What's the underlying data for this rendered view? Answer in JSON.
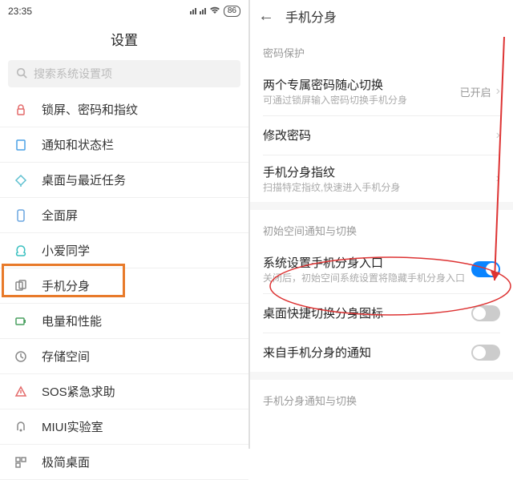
{
  "statusBar": {
    "time": "23:35",
    "battery": "86"
  },
  "left": {
    "title": "设置",
    "searchPlaceholder": "搜索系统设置项",
    "items": [
      {
        "label": "锁屏、密码和指纹",
        "iconColor": "#e46a6a"
      },
      {
        "label": "通知和状态栏",
        "iconColor": "#4aa0e6"
      },
      {
        "label": "桌面与最近任务",
        "iconColor": "#5fc0d0"
      },
      {
        "label": "全面屏",
        "iconColor": "#6aa6e0"
      },
      {
        "label": "小爱同学",
        "iconColor": "#3ac0c0"
      },
      {
        "label": "手机分身",
        "iconColor": "#888"
      },
      {
        "label": "电量和性能",
        "iconColor": "#4aa060"
      },
      {
        "label": "存储空间",
        "iconColor": "#888"
      },
      {
        "label": "SOS紧急求助",
        "iconColor": "#e46a6a"
      },
      {
        "label": "MIUI实验室",
        "iconColor": "#888"
      },
      {
        "label": "极简桌面",
        "iconColor": "#888"
      }
    ],
    "highlightIndex": 5
  },
  "right": {
    "headerTitle": "手机分身",
    "section1Label": "密码保护",
    "item1": {
      "title": "两个专属密码随心切换",
      "desc": "可通过锁屏输入密码切换手机分身",
      "status": "已开启"
    },
    "item2": {
      "title": "修改密码"
    },
    "item3": {
      "title": "手机分身指纹",
      "desc": "扫描特定指纹,快速进入手机分身"
    },
    "section2Label": "初始空间通知与切换",
    "item4": {
      "title": "系统设置手机分身入口",
      "desc": "关闭后，初始空间系统设置将隐藏手机分身入口",
      "on": true
    },
    "item5": {
      "title": "桌面快捷切换分身图标",
      "on": false
    },
    "item6": {
      "title": "来自手机分身的通知",
      "on": false
    },
    "section3Label": "手机分身通知与切换"
  }
}
